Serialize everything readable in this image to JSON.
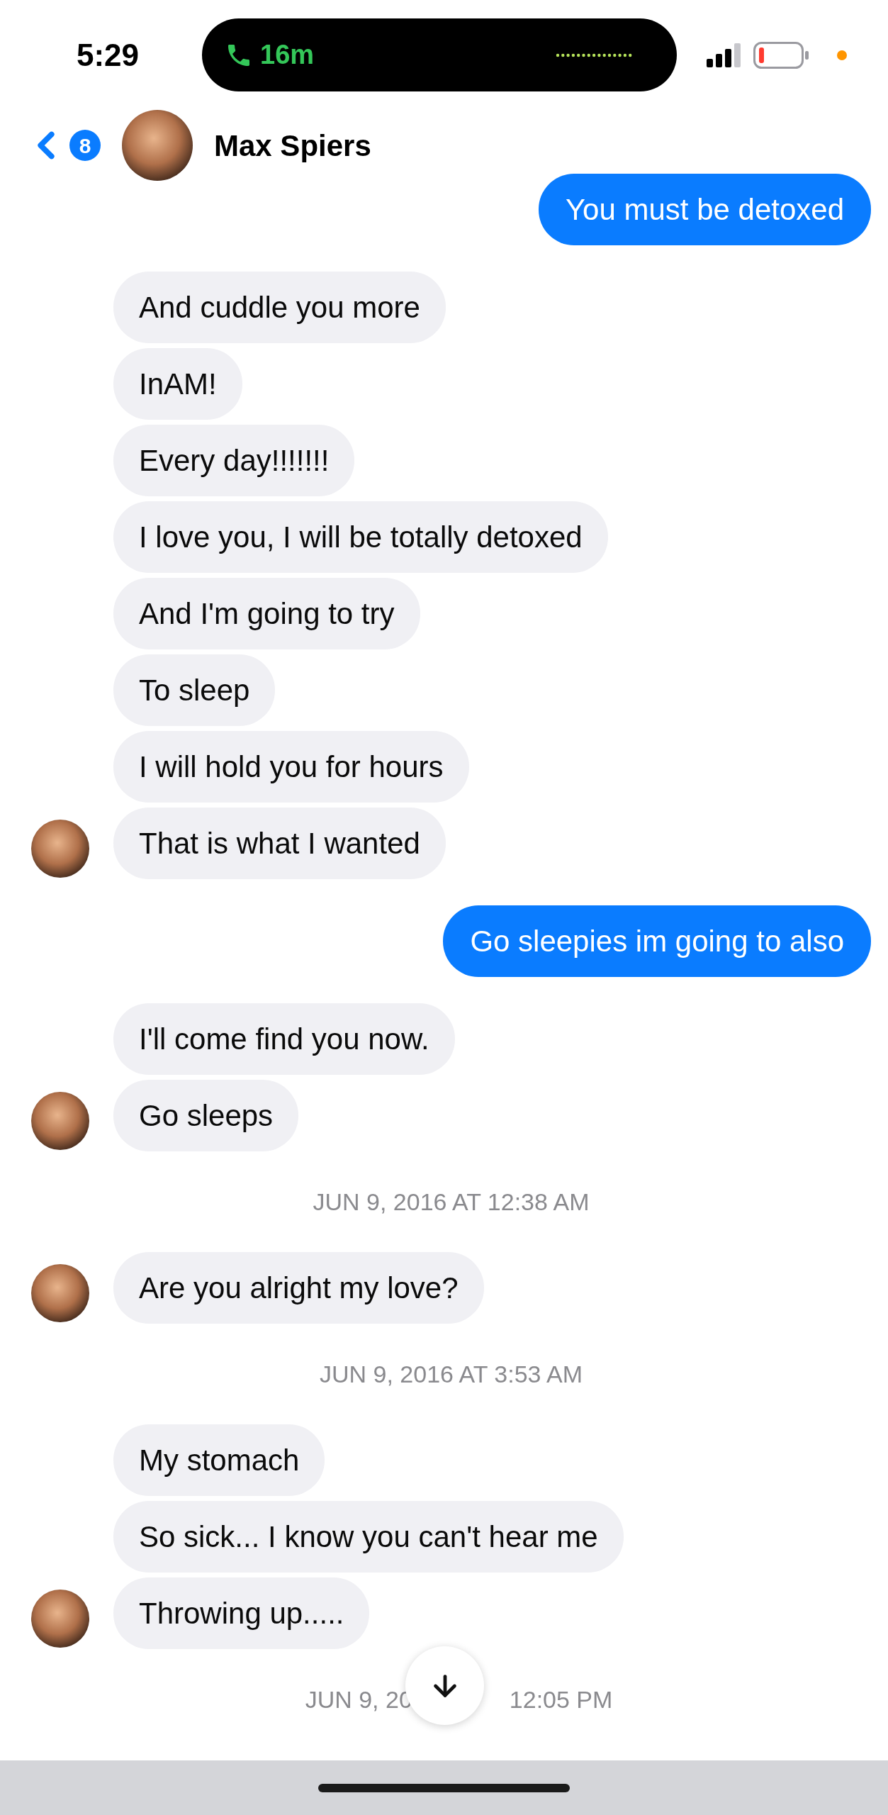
{
  "status_bar": {
    "time": "5:29",
    "call_duration": "16m"
  },
  "header": {
    "unread_count": "8",
    "contact_name": "Max Spiers"
  },
  "messages": [
    {
      "kind": "outgoing",
      "text": "You must be detoxed"
    },
    {
      "kind": "incoming",
      "text": "And cuddle you more",
      "avatar": false
    },
    {
      "kind": "incoming",
      "text": "InAM!",
      "avatar": false
    },
    {
      "kind": "incoming",
      "text": "Every day!!!!!!!",
      "avatar": false
    },
    {
      "kind": "incoming",
      "text": "I love you, I will be totally detoxed",
      "avatar": false
    },
    {
      "kind": "incoming",
      "text": "And I'm going to try",
      "avatar": false
    },
    {
      "kind": "incoming",
      "text": "To sleep",
      "avatar": false
    },
    {
      "kind": "incoming",
      "text": "I will hold you for hours",
      "avatar": false
    },
    {
      "kind": "incoming",
      "text": "That is what I wanted",
      "avatar": true
    },
    {
      "kind": "outgoing",
      "text": "Go sleepies im going to also"
    },
    {
      "kind": "incoming",
      "text": "I'll come find you now.",
      "avatar": false
    },
    {
      "kind": "incoming",
      "text": "Go sleeps",
      "avatar": true
    },
    {
      "kind": "timestamp",
      "text": "JUN 9, 2016 AT 12:38 AM"
    },
    {
      "kind": "incoming",
      "text": "Are you alright my love?",
      "avatar": true
    },
    {
      "kind": "timestamp",
      "text": "JUN 9, 2016 AT 3:53 AM"
    },
    {
      "kind": "incoming",
      "text": "My stomach",
      "avatar": false
    },
    {
      "kind": "incoming",
      "text": "So sick... I know you can't hear me",
      "avatar": false
    },
    {
      "kind": "incoming",
      "text": "Throwing up.....",
      "avatar": true
    },
    {
      "kind": "timestamp_partial",
      "left": "JUN 9, 20",
      "right": "12:05 PM"
    }
  ]
}
